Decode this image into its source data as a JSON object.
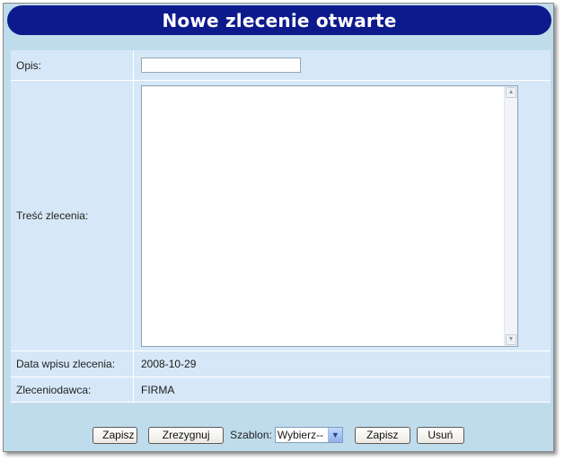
{
  "window": {
    "title": "Nowe zlecenie otwarte"
  },
  "form": {
    "opis_label": "Opis:",
    "opis_value": "",
    "tresc_label": "Treść zlecenia:",
    "tresc_value": "",
    "data_label": "Data wpisu zlecenia:",
    "data_value": "2008-10-29",
    "zleceniodawca_label": "Zleceniodawca:",
    "zleceniodawca_value": "FIRMA"
  },
  "buttons": {
    "zapisz_label": "Zapisz",
    "zrezygnuj_label": "Zrezygnuj",
    "szablon_label": "Szablon:",
    "szablon_selected": "Wybierz--",
    "zapisz2_label": "Zapisz",
    "usun_label": "Usuń"
  },
  "colors": {
    "title_bg": "#0d1a8c",
    "panel_bg": "#bfdcec",
    "table_bg": "#d6e8f8"
  },
  "icons": {
    "scroll_up": "chevron-up-icon",
    "scroll_down": "chevron-down-icon",
    "select_arrow": "chevron-down-icon"
  }
}
